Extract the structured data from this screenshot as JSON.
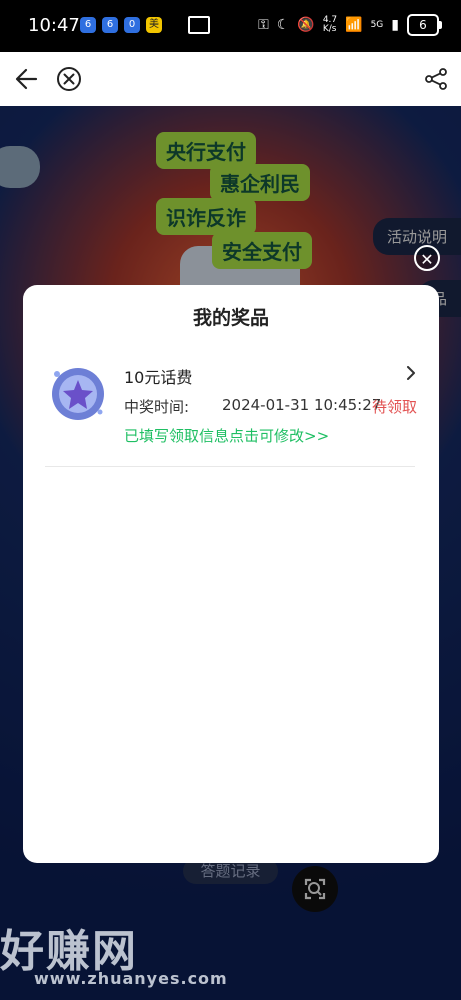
{
  "status_bar": {
    "time": "10:47",
    "app_icons": [
      "6",
      "6",
      "0",
      "美"
    ],
    "net_speed_value": "4.7",
    "net_speed_unit": "K/s",
    "network": "5G",
    "battery": "6"
  },
  "navbar": {
    "back_icon": "arrow-left",
    "close_icon": "circle-x",
    "share_icon": "share-nodes"
  },
  "background": {
    "tags": [
      "央行支付",
      "惠企利民",
      "识诈反诈",
      "安全支付"
    ],
    "side_buttons": [
      "活动说明",
      "品"
    ],
    "answer_record": "答题记录"
  },
  "modal": {
    "title": "我的奖品",
    "prize": {
      "name": "10元话费",
      "time_label": "中奖时间:",
      "time_value": "2024-01-31 10:45:27",
      "status": "待领取",
      "edit_link": "已填写领取信息点击可修改>>"
    }
  },
  "watermark": {
    "text": "好赚网",
    "url": "www.zhuanyes.com"
  },
  "colors": {
    "status_pending": "#e25252",
    "edit_link": "#1fbf63",
    "modal_bg": "#ffffff"
  }
}
